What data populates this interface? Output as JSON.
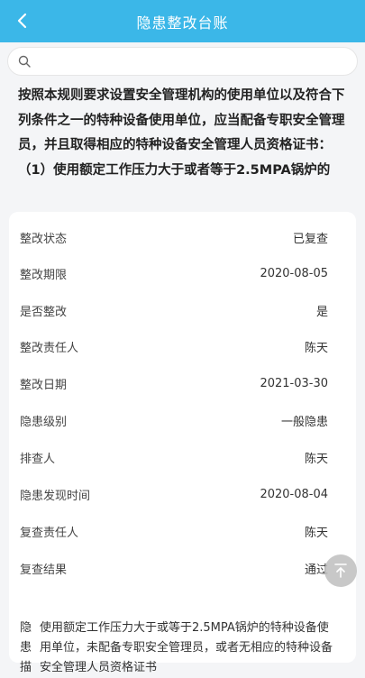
{
  "header": {
    "title": "隐患整改台账"
  },
  "search": {
    "placeholder": "",
    "value": ""
  },
  "headline": "按照本规则要求设置安全管理机构的使用单位以及符合下列条件之一的特种设备使用单位，应当配备专职安全管理员，并且取得相应的特种设备安全管理人员资格证书：（1）使用额定工作压力大于或者等于2.5MPA锅炉的",
  "details": [
    {
      "label": "整改状态",
      "value": "已复查"
    },
    {
      "label": "整改期限",
      "value": "2020-08-05"
    },
    {
      "label": "是否整改",
      "value": "是"
    },
    {
      "label": "整改责任人",
      "value": "陈天"
    },
    {
      "label": "整改日期",
      "value": "2021-03-30"
    },
    {
      "label": "隐患级别",
      "value": "一般隐患"
    },
    {
      "label": "排查人",
      "value": "陈天"
    },
    {
      "label": "隐患发现时间",
      "value": "2020-08-04"
    },
    {
      "label": "复查责任人",
      "value": "陈天"
    },
    {
      "label": "复查结果",
      "value": "通过"
    }
  ],
  "description": {
    "label": "隐患描",
    "text": "使用额定工作压力大于或等于2.5MPA锅炉的特种设备使用单位，未配备专职安全管理员，或者无相应的特种设备安全管理人员资格证书"
  },
  "icons": {
    "back": "chevron-left-icon",
    "search": "search-icon",
    "to_top": "arrow-up-to-top-icon"
  },
  "colors": {
    "header": "#3bb7e8",
    "background": "#f4f5f7"
  }
}
